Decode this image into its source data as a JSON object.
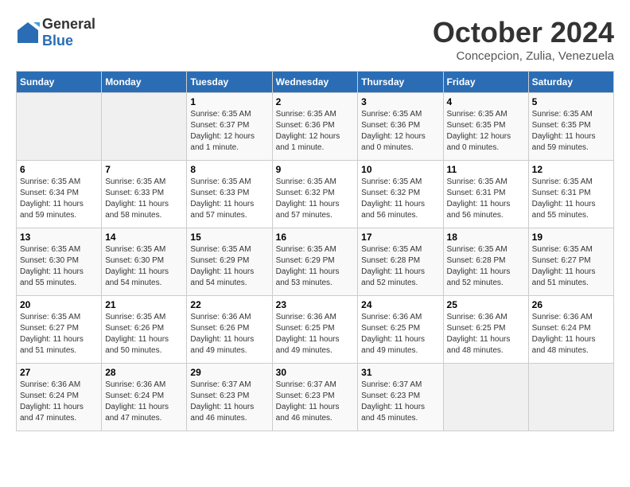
{
  "header": {
    "logo_general": "General",
    "logo_blue": "Blue",
    "month": "October 2024",
    "location": "Concepcion, Zulia, Venezuela"
  },
  "days_of_week": [
    "Sunday",
    "Monday",
    "Tuesday",
    "Wednesday",
    "Thursday",
    "Friday",
    "Saturday"
  ],
  "weeks": [
    [
      {
        "num": "",
        "empty": true
      },
      {
        "num": "",
        "empty": true
      },
      {
        "num": "1",
        "sunrise": "6:35 AM",
        "sunset": "6:37 PM",
        "daylight": "12 hours and 1 minute."
      },
      {
        "num": "2",
        "sunrise": "6:35 AM",
        "sunset": "6:36 PM",
        "daylight": "12 hours and 1 minute."
      },
      {
        "num": "3",
        "sunrise": "6:35 AM",
        "sunset": "6:36 PM",
        "daylight": "12 hours and 0 minutes."
      },
      {
        "num": "4",
        "sunrise": "6:35 AM",
        "sunset": "6:35 PM",
        "daylight": "12 hours and 0 minutes."
      },
      {
        "num": "5",
        "sunrise": "6:35 AM",
        "sunset": "6:35 PM",
        "daylight": "11 hours and 59 minutes."
      }
    ],
    [
      {
        "num": "6",
        "sunrise": "6:35 AM",
        "sunset": "6:34 PM",
        "daylight": "11 hours and 59 minutes."
      },
      {
        "num": "7",
        "sunrise": "6:35 AM",
        "sunset": "6:33 PM",
        "daylight": "11 hours and 58 minutes."
      },
      {
        "num": "8",
        "sunrise": "6:35 AM",
        "sunset": "6:33 PM",
        "daylight": "11 hours and 57 minutes."
      },
      {
        "num": "9",
        "sunrise": "6:35 AM",
        "sunset": "6:32 PM",
        "daylight": "11 hours and 57 minutes."
      },
      {
        "num": "10",
        "sunrise": "6:35 AM",
        "sunset": "6:32 PM",
        "daylight": "11 hours and 56 minutes."
      },
      {
        "num": "11",
        "sunrise": "6:35 AM",
        "sunset": "6:31 PM",
        "daylight": "11 hours and 56 minutes."
      },
      {
        "num": "12",
        "sunrise": "6:35 AM",
        "sunset": "6:31 PM",
        "daylight": "11 hours and 55 minutes."
      }
    ],
    [
      {
        "num": "13",
        "sunrise": "6:35 AM",
        "sunset": "6:30 PM",
        "daylight": "11 hours and 55 minutes."
      },
      {
        "num": "14",
        "sunrise": "6:35 AM",
        "sunset": "6:30 PM",
        "daylight": "11 hours and 54 minutes."
      },
      {
        "num": "15",
        "sunrise": "6:35 AM",
        "sunset": "6:29 PM",
        "daylight": "11 hours and 54 minutes."
      },
      {
        "num": "16",
        "sunrise": "6:35 AM",
        "sunset": "6:29 PM",
        "daylight": "11 hours and 53 minutes."
      },
      {
        "num": "17",
        "sunrise": "6:35 AM",
        "sunset": "6:28 PM",
        "daylight": "11 hours and 52 minutes."
      },
      {
        "num": "18",
        "sunrise": "6:35 AM",
        "sunset": "6:28 PM",
        "daylight": "11 hours and 52 minutes."
      },
      {
        "num": "19",
        "sunrise": "6:35 AM",
        "sunset": "6:27 PM",
        "daylight": "11 hours and 51 minutes."
      }
    ],
    [
      {
        "num": "20",
        "sunrise": "6:35 AM",
        "sunset": "6:27 PM",
        "daylight": "11 hours and 51 minutes."
      },
      {
        "num": "21",
        "sunrise": "6:35 AM",
        "sunset": "6:26 PM",
        "daylight": "11 hours and 50 minutes."
      },
      {
        "num": "22",
        "sunrise": "6:36 AM",
        "sunset": "6:26 PM",
        "daylight": "11 hours and 49 minutes."
      },
      {
        "num": "23",
        "sunrise": "6:36 AM",
        "sunset": "6:25 PM",
        "daylight": "11 hours and 49 minutes."
      },
      {
        "num": "24",
        "sunrise": "6:36 AM",
        "sunset": "6:25 PM",
        "daylight": "11 hours and 49 minutes."
      },
      {
        "num": "25",
        "sunrise": "6:36 AM",
        "sunset": "6:25 PM",
        "daylight": "11 hours and 48 minutes."
      },
      {
        "num": "26",
        "sunrise": "6:36 AM",
        "sunset": "6:24 PM",
        "daylight": "11 hours and 48 minutes."
      }
    ],
    [
      {
        "num": "27",
        "sunrise": "6:36 AM",
        "sunset": "6:24 PM",
        "daylight": "11 hours and 47 minutes."
      },
      {
        "num": "28",
        "sunrise": "6:36 AM",
        "sunset": "6:24 PM",
        "daylight": "11 hours and 47 minutes."
      },
      {
        "num": "29",
        "sunrise": "6:37 AM",
        "sunset": "6:23 PM",
        "daylight": "11 hours and 46 minutes."
      },
      {
        "num": "30",
        "sunrise": "6:37 AM",
        "sunset": "6:23 PM",
        "daylight": "11 hours and 46 minutes."
      },
      {
        "num": "31",
        "sunrise": "6:37 AM",
        "sunset": "6:23 PM",
        "daylight": "11 hours and 45 minutes."
      },
      {
        "num": "",
        "empty": true
      },
      {
        "num": "",
        "empty": true
      }
    ]
  ]
}
